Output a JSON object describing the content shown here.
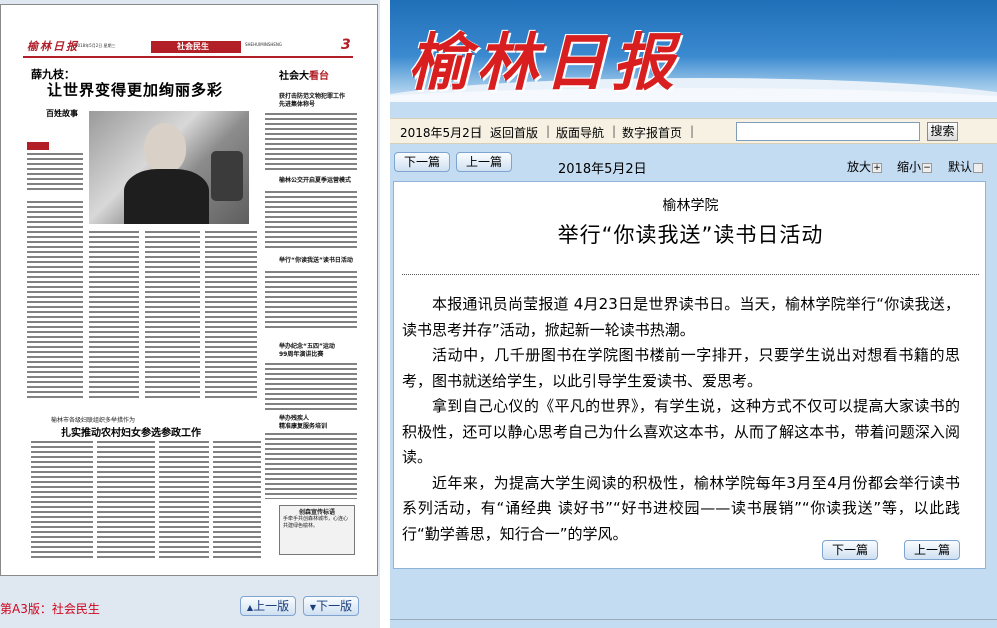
{
  "paper": {
    "logo": "榆林日报",
    "date_line": "2018年5月2日 星期三",
    "section": "社会民生",
    "section_en": "SHEHUIMINSHENG",
    "page_num": "3",
    "headline_pre": "薛九枝：",
    "headline": "让世界变得更加绚丽多彩",
    "column_name": "百姓故事",
    "side_title_a": "社会大",
    "side_title_b": "看台",
    "sub_1": "获打击防范文物犯罪工作\n先进集体称号",
    "sub_2": "榆林公交开启夏季运营模式",
    "sub_3": "举行“你读我送”读书日活动",
    "sub_4": "举办纪念“五四”运动\n99周年演讲比赛",
    "sub_5": "举办残疾人\n精准康复服务培训",
    "mid_pre": "榆林市各级妇联组织多举措作为",
    "mid_head": "扎实推动农村妇女参选参政工作",
    "stamp_title": "创森宣传标语",
    "stamp_text": "手牵手共创森林城市，心连心共建绿色榆林。"
  },
  "left_footer": {
    "page_label": "第A3版：社会民生",
    "prev_page": "上一版",
    "next_page": "下一版"
  },
  "banner": {
    "logo": "榆林日报"
  },
  "nav": {
    "date": "2018年5月2日",
    "links": [
      "返回首版",
      "版面导航",
      "数字报首页"
    ],
    "search_placeholder": "",
    "search_button": "搜索"
  },
  "toolbar": {
    "next_article": "下一篇",
    "prev_article": "上一篇",
    "date": "2018年5月2日",
    "zoom_in": "放大",
    "zoom_out": "缩小",
    "default": "默认"
  },
  "article": {
    "pretitle": "榆林学院",
    "title": "举行“你读我送”读书日活动",
    "paragraphs": [
      "本报通讯员尚莹报道 4月23日是世界读书日。当天，榆林学院举行“你读我送，读书思考并存”活动，掀起新一轮读书热潮。",
      "活动中，几千册图书在学院图书楼前一字排开，只要学生说出对想看书籍的思考，图书就送给学生，以此引导学生爱读书、爱思考。",
      "拿到自己心仪的《平凡的世界》，有学生说，这种方式不仅可以提高大家读书的积极性，还可以静心思考自己为什么喜欢这本书，从而了解这本书，带着问题深入阅读。",
      "近年来，为提高大学生阅读的积极性，榆林学院每年3月至4月份都会举行读书系列活动，有“诵经典 读好书”“好书进校园——读书展销”“你读我送”等，以此践行“勤学善思，知行合一”的学风。"
    ],
    "next_button": "下一篇",
    "prev_button": "上一篇"
  },
  "colors": {
    "brand_red": "#d81e1e",
    "banner_blue": "#1f6fb8",
    "page_bg": "#c4dcf1"
  }
}
